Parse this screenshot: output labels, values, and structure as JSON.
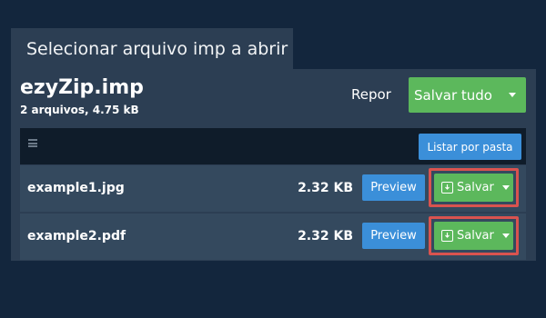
{
  "dialog": {
    "title": "Selecionar arquivo imp a abrir"
  },
  "archive": {
    "name": "ezyZip.imp",
    "info": "2 arquivos, 4.75 kB"
  },
  "actions": {
    "reset_label": "Repor",
    "save_all_label": "Salvar tudo"
  },
  "toolbar": {
    "list_by_folder_label": "Listar por pasta"
  },
  "files": [
    {
      "name": "example1.jpg",
      "size": "2.32 KB",
      "preview_label": "Preview",
      "save_label": "Salvar"
    },
    {
      "name": "example2.pdf",
      "size": "2.32 KB",
      "preview_label": "Preview",
      "save_label": "Salvar"
    }
  ],
  "colors": {
    "background": "#13263d",
    "panel": "#2c3e53",
    "success": "#5cb85c",
    "primary": "#3b8fd9",
    "highlight": "#d9534f"
  }
}
